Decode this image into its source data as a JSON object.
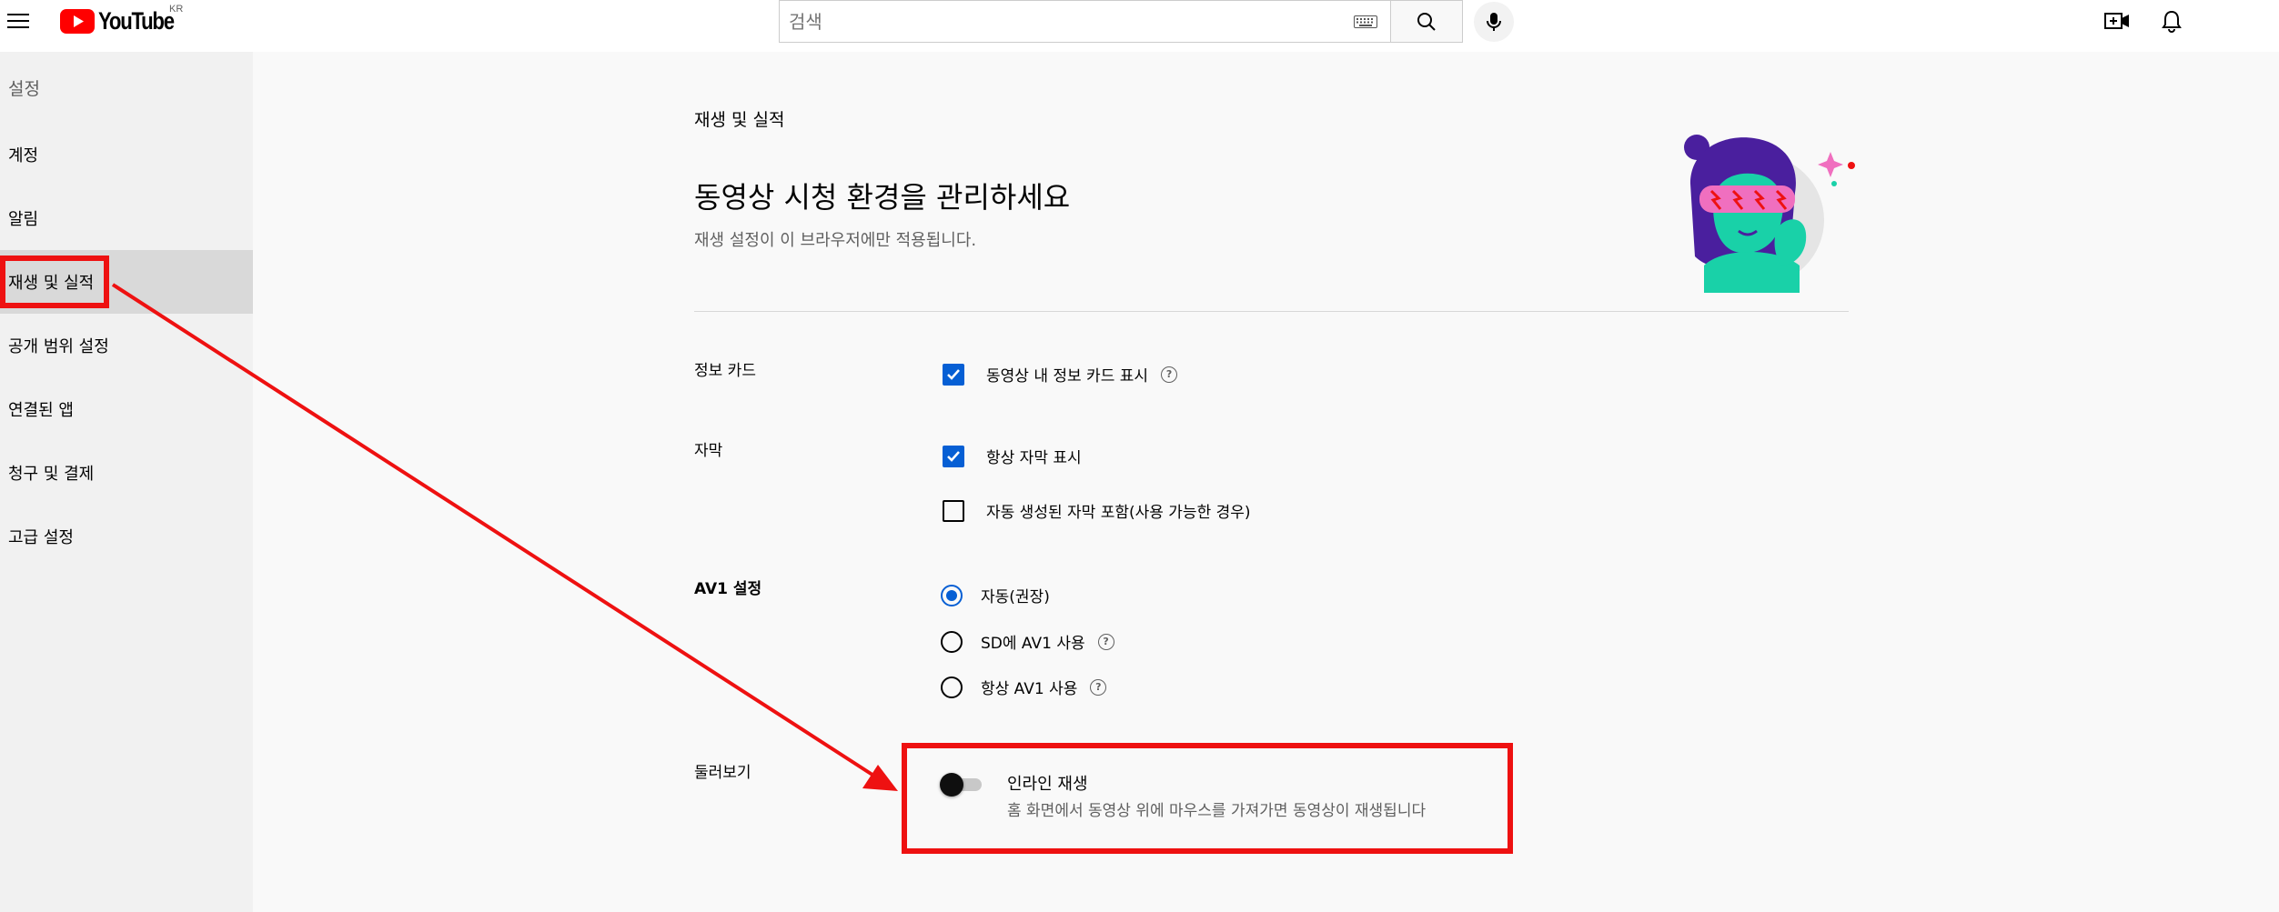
{
  "header": {
    "logo_text": "YouTube",
    "region": "KR",
    "search_placeholder": "검색"
  },
  "sidebar": {
    "title": "설정",
    "items": [
      {
        "label": "계정"
      },
      {
        "label": "알림"
      },
      {
        "label": "재생 및 실적"
      },
      {
        "label": "공개 범위 설정"
      },
      {
        "label": "연결된 앱"
      },
      {
        "label": "청구 및 결제"
      },
      {
        "label": "고급 설정"
      }
    ]
  },
  "main": {
    "section_title": "재생 및 실적",
    "headline": "동영상 시청 환경을 관리하세요",
    "subtext": "재생 설정이 이 브라우저에만 적용됩니다.",
    "info_cards": {
      "label": "정보 카드",
      "option": "동영상 내 정보 카드 표시",
      "checked": true
    },
    "captions": {
      "label": "자막",
      "option_always": "항상 자막 표시",
      "option_always_checked": true,
      "option_auto": "자동 생성된 자막 포함(사용 가능한 경우)",
      "option_auto_checked": false
    },
    "av1": {
      "label": "AV1 설정",
      "options": [
        {
          "label": "자동(권장)",
          "selected": true
        },
        {
          "label": "SD에 AV1 사용",
          "selected": false
        },
        {
          "label": "항상 AV1 사용",
          "selected": false
        }
      ]
    },
    "browse": {
      "label": "둘러보기",
      "inline_title": "인라인 재생",
      "inline_desc": "홈 화면에서 동영상 위에 마우스를 가져가면 동영상이 재생됩니다",
      "inline_on": false
    },
    "help_glyph": "?"
  },
  "colors": {
    "accent": "#065fd4",
    "annotation": "#ee1111",
    "youtube_red": "#ff0000"
  }
}
